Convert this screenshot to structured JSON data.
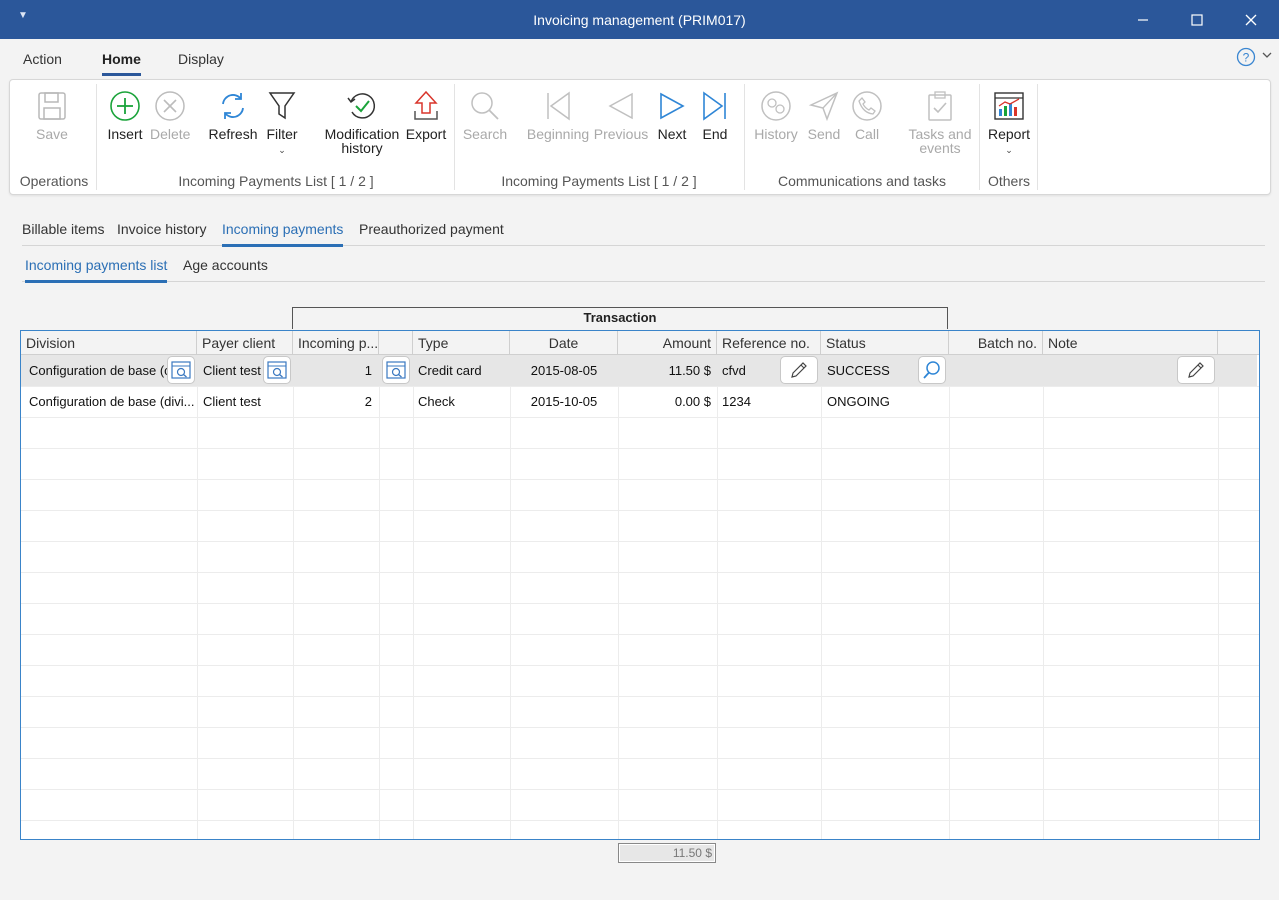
{
  "window": {
    "title": "Invoicing management (PRIM017)"
  },
  "ribbon_tabs": [
    "Action",
    "Home",
    "Display"
  ],
  "ribbon": {
    "save": "Save",
    "insert": "Insert",
    "delete": "Delete",
    "refresh": "Refresh",
    "filter": "Filter",
    "modification_history_1": "Modification",
    "modification_history_2": "history",
    "export": "Export",
    "search": "Search",
    "beginning": "Beginning",
    "previous": "Previous",
    "next": "Next",
    "end": "End",
    "history": "History",
    "send": "Send",
    "call": "Call",
    "tasks_1": "Tasks and",
    "tasks_2": "events",
    "report": "Report",
    "groups": {
      "operations": "Operations",
      "list1": "Incoming Payments List [ 1 / 2 ]",
      "list2": "Incoming Payments List [ 1 / 2 ]",
      "communications": "Communications and tasks",
      "others": "Others"
    }
  },
  "tabs": [
    "Billable items",
    "Invoice history",
    "Incoming payments",
    "Preauthorized payment"
  ],
  "subtabs": [
    "Incoming payments list",
    "Age accounts"
  ],
  "grid": {
    "group_header": "Transaction",
    "columns": {
      "division": "Division",
      "payer": "Payer client",
      "incoming": "Incoming p...",
      "type": "Type",
      "date": "Date",
      "amount": "Amount",
      "reference": "Reference no.",
      "status": "Status",
      "batch": "Batch no.",
      "note": "Note"
    },
    "rows": [
      {
        "division": "Configuration de base (c",
        "payer": "Client test",
        "incoming": "1",
        "type": "Credit card",
        "date": "2015-08-05",
        "amount": "11.50 $",
        "reference": "cfvd",
        "status": "SUCCESS",
        "batch": "",
        "note": ""
      },
      {
        "division": "Configuration de base (divi...",
        "payer": "Client test",
        "incoming": "2",
        "type": "Check",
        "date": "2015-10-05",
        "amount": "0.00 $",
        "reference": "1234",
        "status": "ONGOING",
        "batch": "",
        "note": ""
      }
    ],
    "total": "11.50 $"
  },
  "colors": {
    "accent": "#2b579a",
    "tab_active": "#2b6fb5",
    "green": "#1aa33a",
    "red": "#d9352b"
  }
}
